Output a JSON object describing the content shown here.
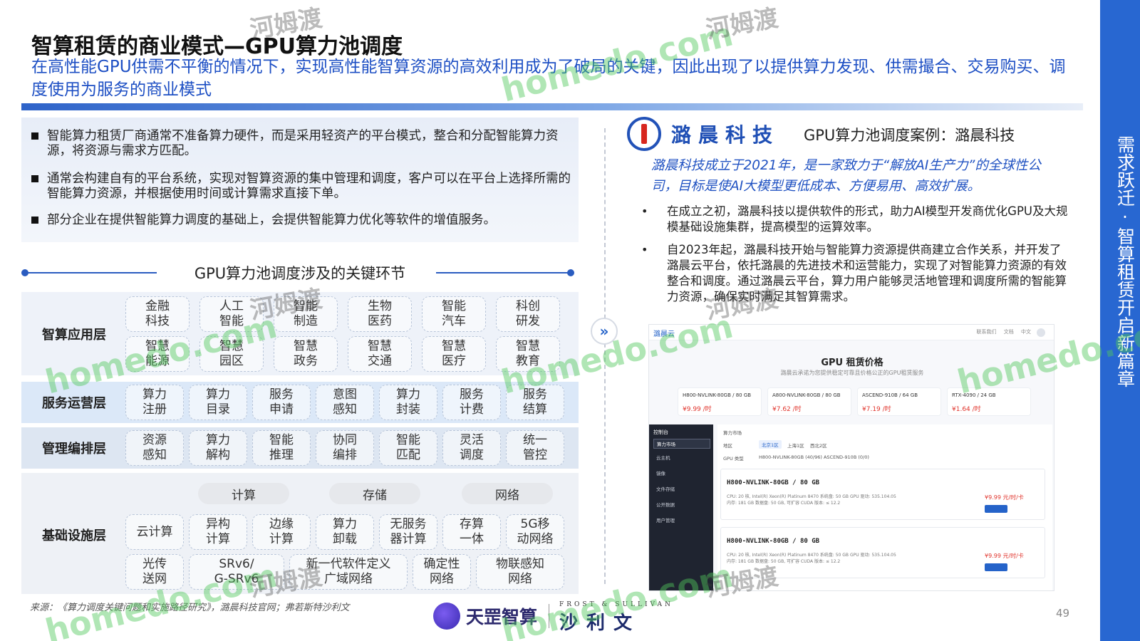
{
  "page": {
    "title": "智算租赁的商业模式—GPU算力池调度",
    "subtitle": "在高性能GPU供需不平衡的情况下，实现高性能智算资源的高效利用成为了破局的关键，因此出现了以提供算力发现、供需撮合、交易购买、调度使用为服务的商业模式",
    "side_label": "需求跃迁·智算租赁开启新篇章",
    "page_number": "49",
    "source": "来源：《算力调度关键问题和实施路径研究》，潞晨科技官网；弗若斯特沙利文"
  },
  "left": {
    "bullets": [
      "智能算力租赁厂商通常不准备算力硬件，而是采用轻资产的平台模式，整合和分配智能算力资源，将资源与需求方匹配。",
      "通常会构建自有的平台系统，实现对智算资源的集中管理和调度，客户可以在平台上选择所需的智能算力资源，并根据使用时间或计算需求直接下单。",
      "部分企业在提供智能算力调度的基础上，会提供智能算力优化等软件的增值服务。"
    ],
    "section_title": "GPU算力池调度涉及的关键环节",
    "layers": {
      "application": {
        "name": "智算应用层",
        "cells": [
          "金融\n科技",
          "人工\n智能",
          "智能\n制造",
          "生物\n医药",
          "智能\n汽车",
          "科创\n研发",
          "智慧\n能源",
          "智慧\n园区",
          "智慧\n政务",
          "智慧\n交通",
          "智慧\n医疗",
          "智慧\n教育"
        ]
      },
      "service": {
        "name": "服务运营层",
        "cells": [
          "算力\n注册",
          "算力\n目录",
          "服务\n申请",
          "意图\n感知",
          "算力\n封装",
          "服务\n计费",
          "服务\n结算"
        ]
      },
      "orchestration": {
        "name": "管理编排层",
        "cells": [
          "资源\n感知",
          "算力\n解构",
          "智能\n推理",
          "协同\n编排",
          "智能\n匹配",
          "灵活\n调度",
          "统一\n管控"
        ]
      },
      "infrastructure": {
        "name": "基础设施层",
        "pills": [
          "计算",
          "存储",
          "网络"
        ],
        "row1": [
          "云计算",
          "异构\n计算",
          "边缘\n计算",
          "算力\n卸载",
          "无服务\n器计算",
          "存算\n一体",
          "5G移\n动网络"
        ],
        "row2": [
          "光传\n送网",
          "SRv6/\nG-SRv6",
          "新一代软件定义\n广域网络",
          "确定性\n网络",
          "物联感知\n网络"
        ]
      }
    }
  },
  "right": {
    "company_name": "潞晨科技",
    "case_title": "GPU算力池调度案例：潞晨科技",
    "intro": "潞晨科技成立于2021年，是一家致力于“解放AI生产力”的全球性公司，目标是使AI大模型更低成本、方便易用、高效扩展。",
    "bullet_mark": "•",
    "bullets": [
      "在成立之初，潞晨科技以提供软件的形式，助力AI模型开发商优化GPU及大规模基础设施集群，提高模型的运算效率。",
      "自2023年起，潞晨科技开始与智能算力资源提供商建立合作关系，并开发了潞晨云平台，依托潞晨的先进技术和运营能力，实现了对智能算力资源的有效整合和调度。通过潞晨云平台，算力用户能够灵活地管理和调度所需的智能算力资源，确保实时满足其智算需求。"
    ],
    "arrow_icon": "»",
    "screenshot": {
      "brand": "潞晨云",
      "nav": "联系我们 文档 中文",
      "heading": "GPU 租赁价格",
      "subheading": "潞晨云承诺为您提供稳定可靠且价格公正的GPU租赁服务",
      "prices": [
        {
          "name": "H800-NVLINK-80GB / 80 GB",
          "price": "¥9.99 /时"
        },
        {
          "name": "A800-NVLINK-80GB / 80 GB",
          "price": "¥7.62 /时"
        },
        {
          "name": "ASCEND-910B / 64 GB",
          "price": "¥7.19 /时"
        },
        {
          "name": "RTX-4090 / 24 GB",
          "price": "¥1.64 /时"
        }
      ],
      "sidebar_title": "控制台",
      "sidebar_items": [
        "算力市场",
        "云主机",
        "镜像",
        "文件存储",
        "公开数据",
        "用户管理"
      ],
      "filter_region_label": "地区",
      "filter_regions": [
        "北京1区",
        "上海1区",
        "西北2区"
      ],
      "filter_gpu_label": "GPU 类型",
      "filter_gpus": "H800-NVLINK-80GB (40/96)   ASCEND-910B (0/0)",
      "breadcrumb": "算力市场",
      "cards": [
        {
          "name": "H800-NVLINK-80GB / 80 GB",
          "meta": "CPU: 20 核, Intel(R) Xeon(R) Platinum 8470   系统盘: 50 GB   GPU 驱动: 535.104.05\n内存: 181 GB   数据盘: 50 GB, 可扩容   CUDA 版本: ≤ 12.2",
          "price": "¥9.99 元/时/卡"
        },
        {
          "name": "H800-NVLINK-80GB / 80 GB",
          "meta": "CPU: 20 核, Intel(R) Xeon(R) Platinum 8470   系统盘: 50 GB   GPU 驱动: 535.104.05\n内存: 181 GB   数据盘: 50 GB, 可扩容   CUDA 版本: ≤ 12.2",
          "price": "¥9.99 元/时/卡"
        }
      ]
    }
  },
  "logos": {
    "tianyi": "天罡智算",
    "frost_small": "FROST & SULLIVAN",
    "frost_big": "沙利文"
  },
  "watermarks": {
    "latin": "homedo.com",
    "cn": "河姆渡"
  }
}
